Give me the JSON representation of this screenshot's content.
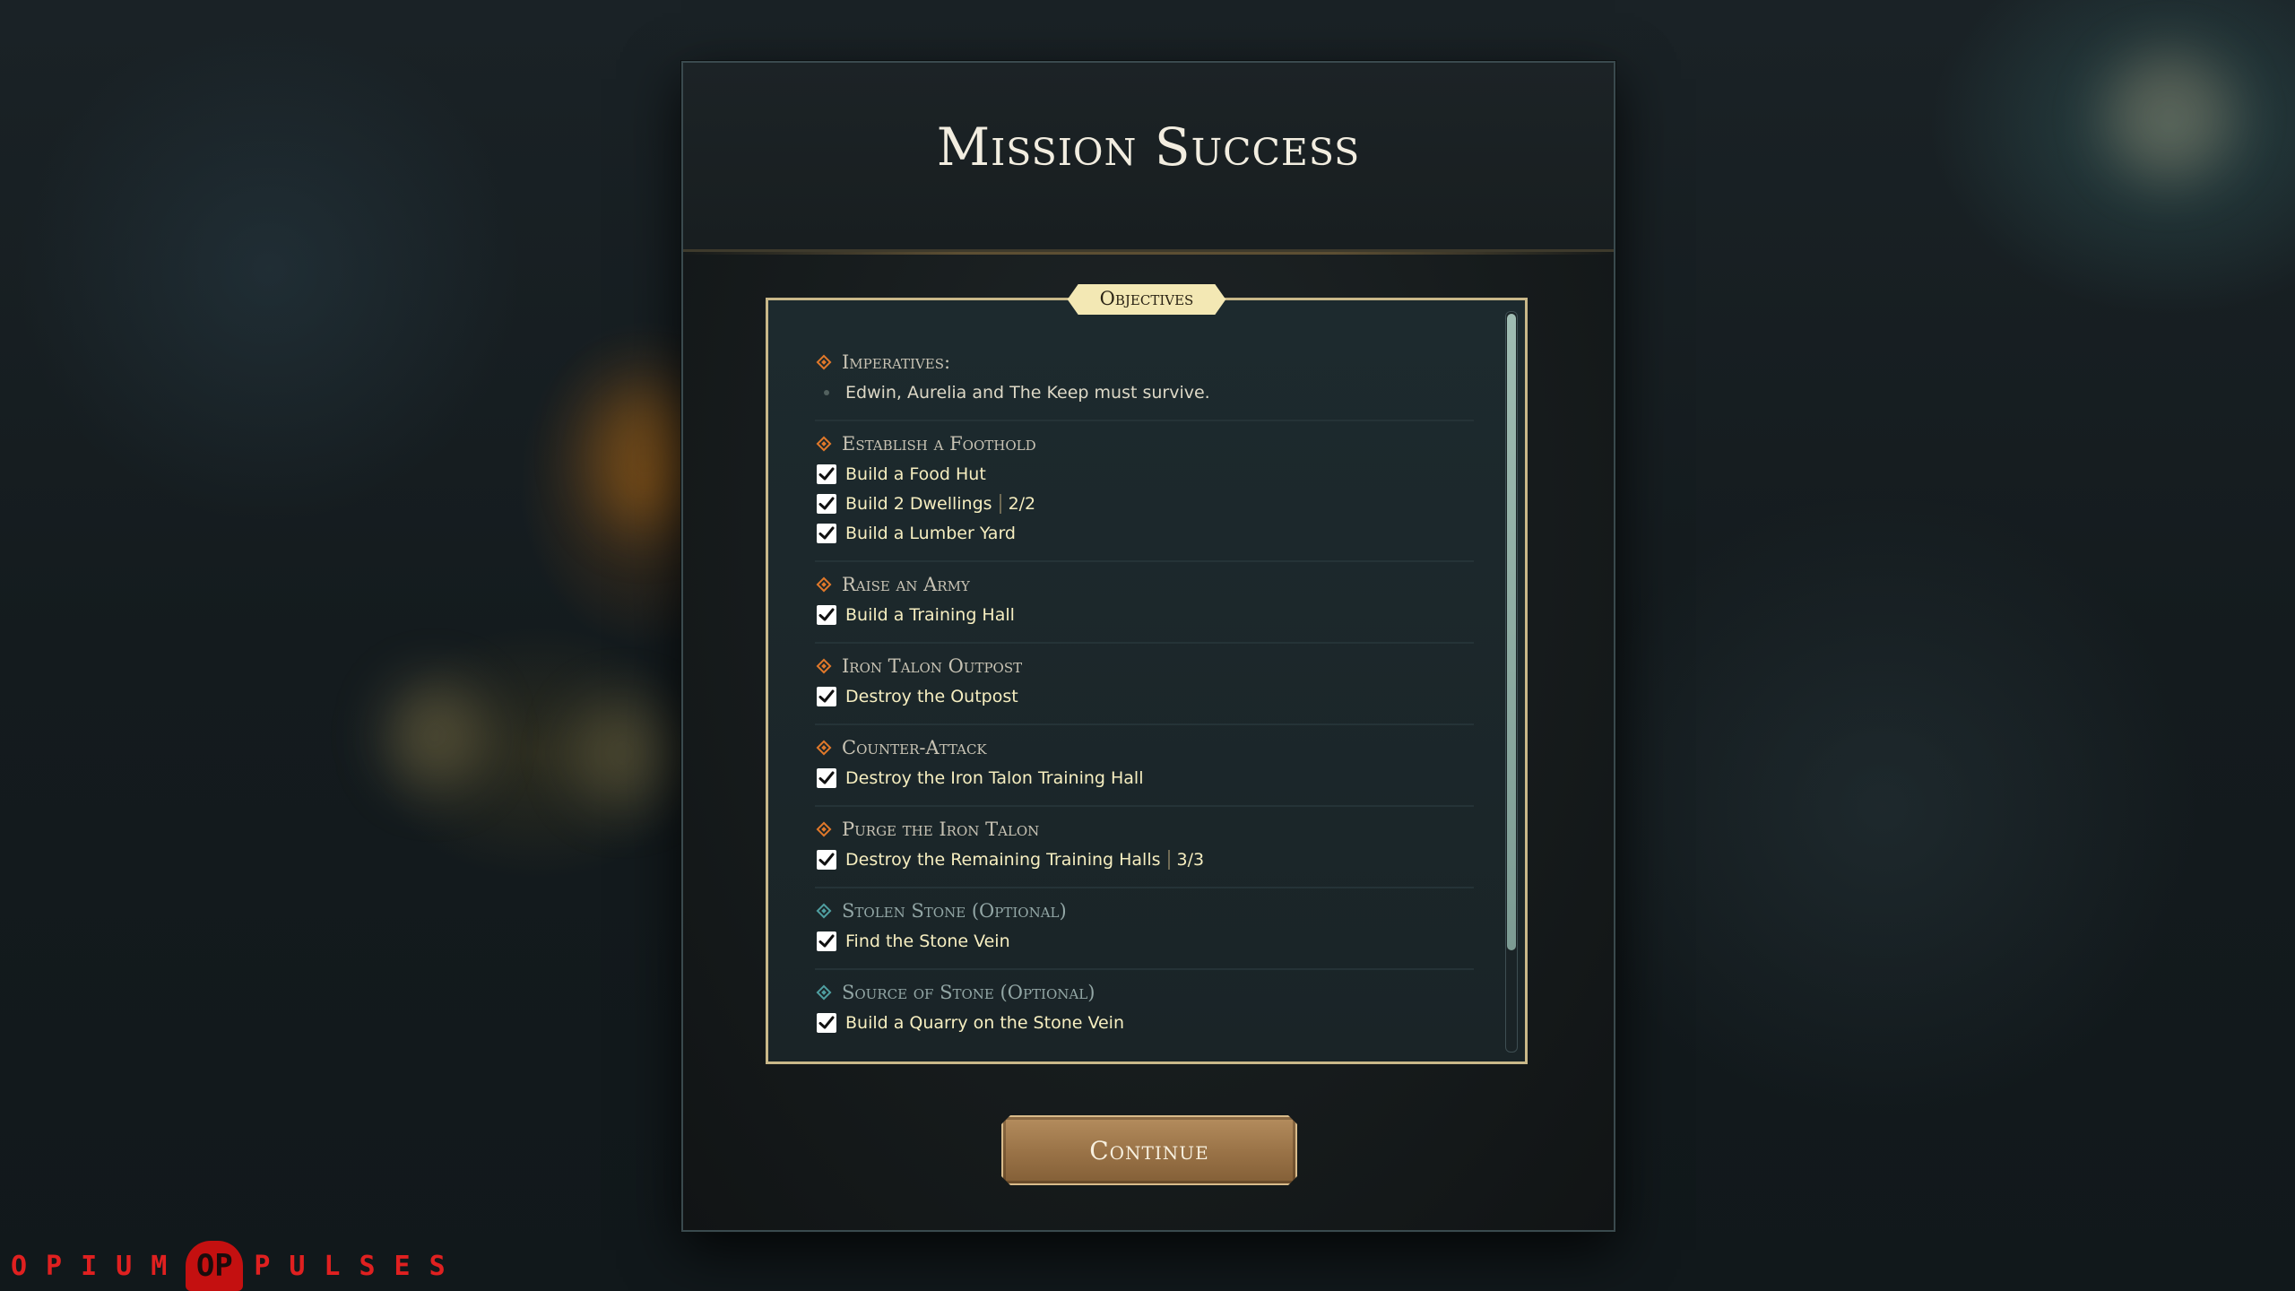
{
  "modal": {
    "title": "Mission Success",
    "objectives_tab": "Objectives",
    "groups": [
      {
        "title": "Imperatives:",
        "optional": false,
        "tasks": [
          {
            "label": "Edwin, Aurelia and The Keep must survive.",
            "checked": false
          }
        ]
      },
      {
        "title": "Establish a Foothold",
        "optional": false,
        "tasks": [
          {
            "label": "Build a Food Hut",
            "checked": true
          },
          {
            "label": "Build 2 Dwellings",
            "count": "2/2",
            "checked": true
          },
          {
            "label": "Build a Lumber Yard",
            "checked": true
          }
        ]
      },
      {
        "title": "Raise an Army",
        "optional": false,
        "tasks": [
          {
            "label": "Build a Training Hall",
            "checked": true
          }
        ]
      },
      {
        "title": "Iron Talon Outpost",
        "optional": false,
        "tasks": [
          {
            "label": "Destroy the Outpost",
            "checked": true
          }
        ]
      },
      {
        "title": "Counter-Attack",
        "optional": false,
        "tasks": [
          {
            "label": "Destroy the Iron Talon Training Hall",
            "checked": true
          }
        ]
      },
      {
        "title": "Purge the Iron Talon",
        "optional": false,
        "tasks": [
          {
            "label": "Destroy the Remaining Training Halls",
            "count": "3/3",
            "checked": true
          }
        ]
      },
      {
        "title": "Stolen Stone (Optional)",
        "optional": true,
        "tasks": [
          {
            "label": "Find the Stone Vein",
            "checked": true
          }
        ]
      },
      {
        "title": "Source of Stone (Optional)",
        "optional": true,
        "tasks": [
          {
            "label": "Build a Quarry on the Stone Vein",
            "checked": true
          }
        ]
      }
    ],
    "continue_label": "Continue"
  },
  "watermark": {
    "left": "OPIUM",
    "logo": "OP",
    "right": "PULSES"
  },
  "colors": {
    "accent_orange": "#e0782a",
    "optional_teal": "#4f9ea0",
    "task_text": "#f6eec0",
    "button": "#9b7448"
  }
}
